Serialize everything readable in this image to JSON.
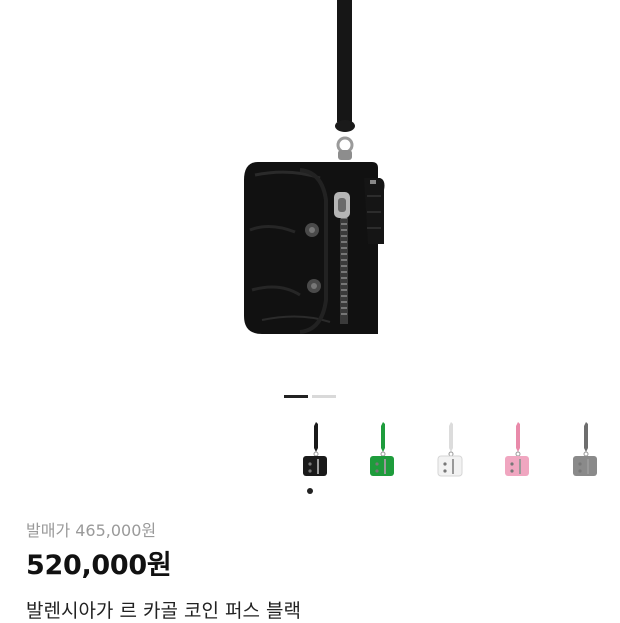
{
  "product": {
    "release_price": "발매가 465,000원",
    "price": "520,000원",
    "title": "발렌시아가 르 카골 코인 퍼스 블랙"
  },
  "gallery": {
    "image_count": 2,
    "current_index": 1
  },
  "variants": [
    {
      "name": "black-variant",
      "color": "#1a1a1a",
      "strap": "#1a1a1a"
    },
    {
      "name": "green-variant",
      "color": "#1e9c3c",
      "strap": "#1e9c3c"
    },
    {
      "name": "white-variant",
      "color": "#f2f2f2",
      "strap": "#dcdcdc"
    },
    {
      "name": "pink-variant",
      "color": "#f0a6c0",
      "strap": "#e98aaa"
    },
    {
      "name": "grey-variant",
      "color": "#8a8a8a",
      "strap": "#6e6e6e"
    }
  ],
  "selected_variant": 0
}
